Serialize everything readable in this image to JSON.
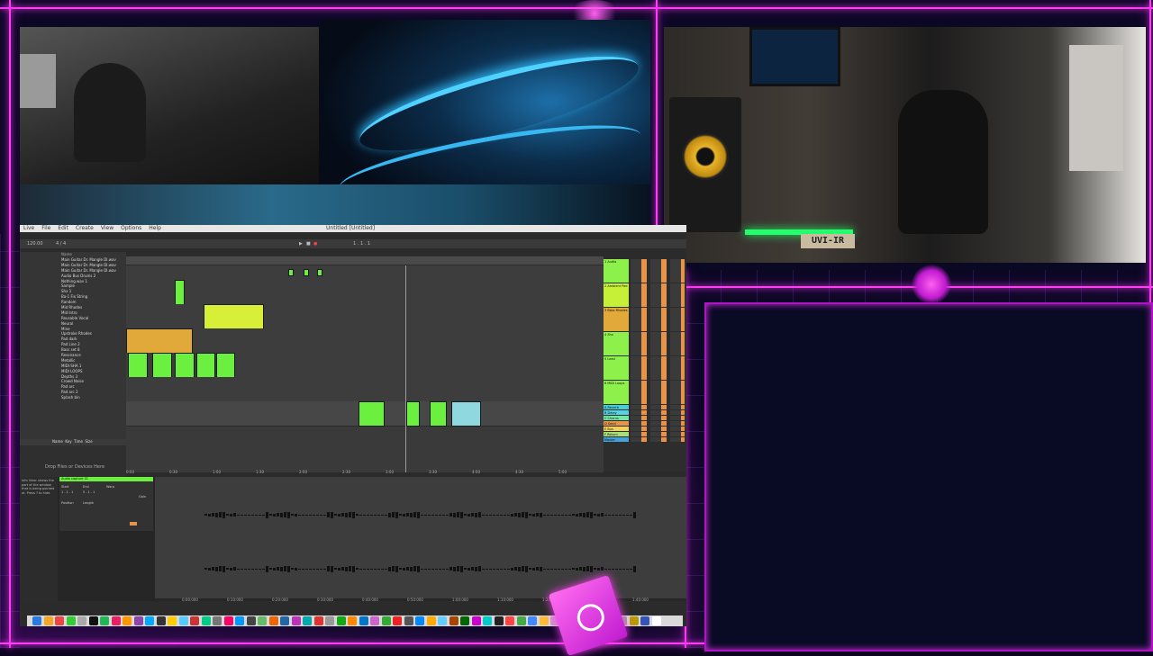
{
  "overlay": {
    "colors": {
      "neon": "#ff3df2",
      "panel": "#090a24",
      "accent_green": "#21ff6a"
    }
  },
  "studio_cam": {
    "desk_tag": "UVI-IR"
  },
  "daw": {
    "window_title": "Untitled  [Untitled]",
    "menu": [
      "Live",
      "File",
      "Edit",
      "Create",
      "View",
      "Options",
      "Help"
    ],
    "tempo": "120.00",
    "signature": "4 / 4",
    "position": "1 . 1 . 1",
    "browser_items": [
      "Main Guitar Dr. Mangle DI.wav",
      "Main Guitar Dr. Mangle DI.wav",
      "Main Guitar Dr. Mangle DI.wav",
      "Audio Bus Drums 2",
      "Nothing.wav 1",
      "Sample",
      "Shx 1",
      "Ba-1 Fix String",
      "Random",
      "Mid Rhodes",
      "Mid Intro",
      "Reusable Vocal",
      "Neural",
      "Mine",
      "Upstroke Rhodes",
      "Pad dark",
      "Pad Line 2",
      "Bass set 8",
      "Resonance",
      "Metallic",
      "MIDI-SHA 1",
      "MIDI LOOPS",
      "Depths 3",
      "Crowd Noise",
      "Pad arc",
      "Pad arc 2",
      "Splash bin"
    ],
    "browser_footer": "Drop Files or Devices Here",
    "browser_header": [
      "Name",
      "Key",
      "Time",
      "Size"
    ],
    "detail_headers": [
      "Start",
      "End",
      "Loop",
      "Position",
      "Length",
      "Warp",
      "Gain"
    ],
    "detail_help": "Info View: shows the part of the window that is being pointed at. Press ? to hide.",
    "clip_name": "Audio capture 01",
    "clip_start": "1 . 1 . 1",
    "clip_end": "5 . 1 . 1",
    "time_marks": [
      "0:00",
      "0:30",
      "1:00",
      "1:30",
      "2:00",
      "2:30",
      "3:00",
      "3:30",
      "4:00",
      "4:30",
      "5:00"
    ],
    "wave_marks": [
      "0:00:000",
      "0:10:000",
      "0:20:000",
      "0:30:000",
      "0:40:000",
      "0:50:000",
      "1:00:000",
      "1:10:000",
      "1:20:000",
      "1:30:000",
      "1:40:000"
    ],
    "mixer_tracks": [
      {
        "name": "1 Audio",
        "color": "#8ef04a"
      },
      {
        "name": "2 Ambient Pad",
        "color": "#c6f037"
      },
      {
        "name": "3 Bass Rhodes",
        "color": "#e0a93a"
      },
      {
        "name": "4 Shx",
        "color": "#8ef04a"
      },
      {
        "name": "5 Lead",
        "color": "#8ef04a"
      },
      {
        "name": "6 MIDI Loops",
        "color": "#8ef04a"
      },
      {
        "name": "A Reverb",
        "color": "#46cdd8"
      },
      {
        "name": "B Delay",
        "color": "#57d2e0"
      },
      {
        "name": "C Chorus",
        "color": "#74e6a5"
      },
      {
        "name": "D Send",
        "color": "#e8934a"
      },
      {
        "name": "E Bus",
        "color": "#f1d258"
      },
      {
        "name": "F Return",
        "color": "#a6e07a"
      },
      {
        "name": "Master",
        "color": "#46a0d8"
      }
    ]
  }
}
